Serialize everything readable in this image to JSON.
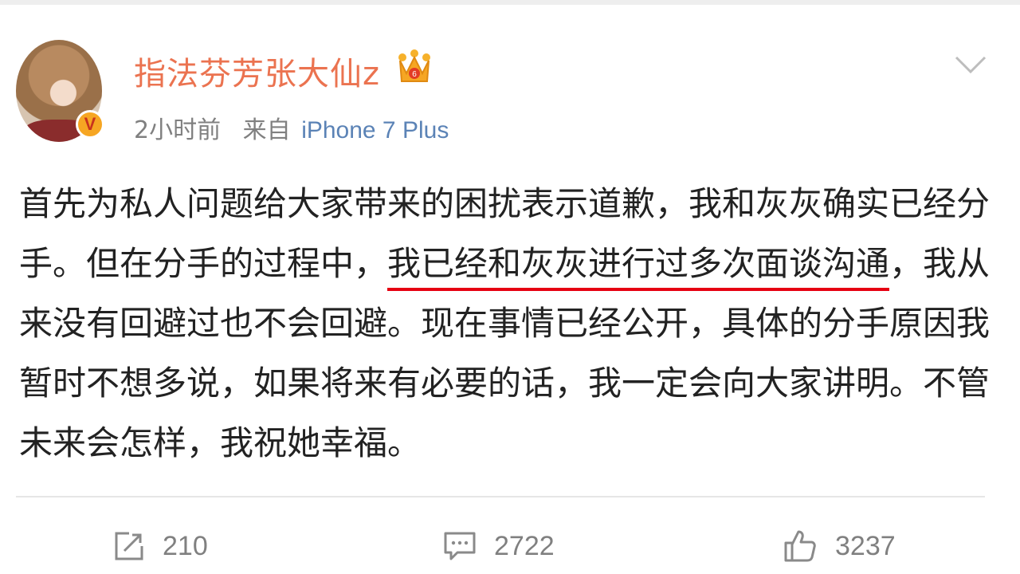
{
  "post": {
    "username": "指法芬芳张大仙z",
    "time": "2小时前",
    "source_prefix": "来自",
    "device": "iPhone 7 Plus",
    "text_part1": "首先为私人问题给大家带来的困扰表示道歉，我和灰灰确实已经分手。但在分手的过程中，",
    "text_highlight": "我已经和灰灰进行过多次面谈沟通",
    "text_part2": "，我从来没有回避过也不会回避。现在事情已经公开，具体的分手原因我暂时不想多说，如果将来有必要的话，我一定会向大家讲明。不管未来会怎样，我祝她幸福。",
    "highlight_color": "#e60012",
    "username_color": "#eb7350",
    "device_color": "#5b83b6"
  },
  "actions": {
    "repost_count": "210",
    "comment_count": "2722",
    "like_count": "3237"
  },
  "icons": {
    "verified": "verified-v-badge-icon",
    "member": "crown-icon",
    "menu": "chevron-down-icon",
    "repost": "repost-icon",
    "comment": "comment-icon",
    "like": "thumbs-up-icon"
  },
  "badge_letter": "V"
}
